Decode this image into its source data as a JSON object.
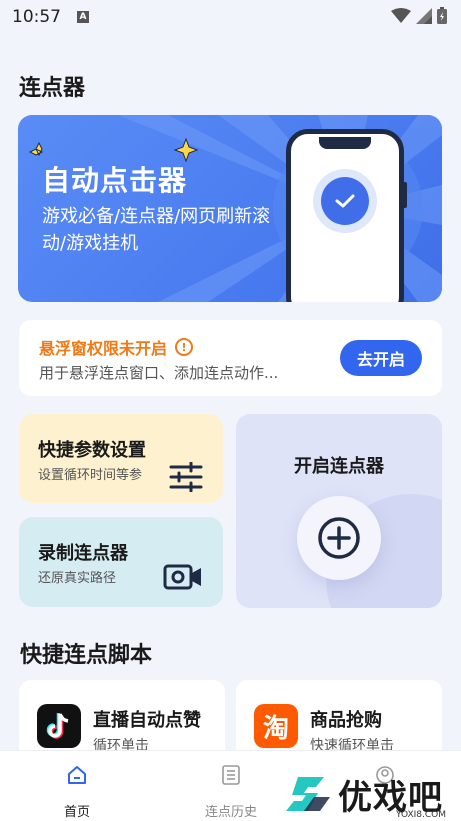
{
  "status_bar": {
    "time": "10:57",
    "notification_badge": "A"
  },
  "page": {
    "title": "连点器"
  },
  "banner": {
    "title": "自动点击器",
    "subtitle": "游戏必备/连点器/网页刷新滚动/游戏挂机",
    "colors": {
      "background": "#4a7cf0",
      "accent_star": "#ffd84a"
    }
  },
  "permission": {
    "title": "悬浮窗权限未开启",
    "description": "用于悬浮连点窗口、添加连点动作...",
    "button_label": "去开启",
    "title_color": "#f07a16"
  },
  "tiles": {
    "quick_settings": {
      "title": "快捷参数设置",
      "subtitle": "设置循环时间等参"
    },
    "record": {
      "title": "录制连点器",
      "subtitle": "还原真实路径"
    },
    "start": {
      "title": "开启连点器"
    }
  },
  "scripts": {
    "section_title": "快捷连点脚本",
    "items": [
      {
        "name": "直播自动点赞",
        "subtitle": "循环单击",
        "icon": "tiktok-logo"
      },
      {
        "name": "商品抢购",
        "subtitle": "快速循环单击",
        "icon": "taobao-logo",
        "logo_text": "淘"
      }
    ]
  },
  "bottom_nav": {
    "items": [
      {
        "label": "首页",
        "icon": "home-icon",
        "active": true
      },
      {
        "label": "连点历史",
        "icon": "history-list-icon",
        "active": false
      },
      {
        "label": "",
        "icon": "profile-icon",
        "active": false
      }
    ]
  },
  "watermark": {
    "text": "优戏吧",
    "url": "YOXI8.COM"
  }
}
